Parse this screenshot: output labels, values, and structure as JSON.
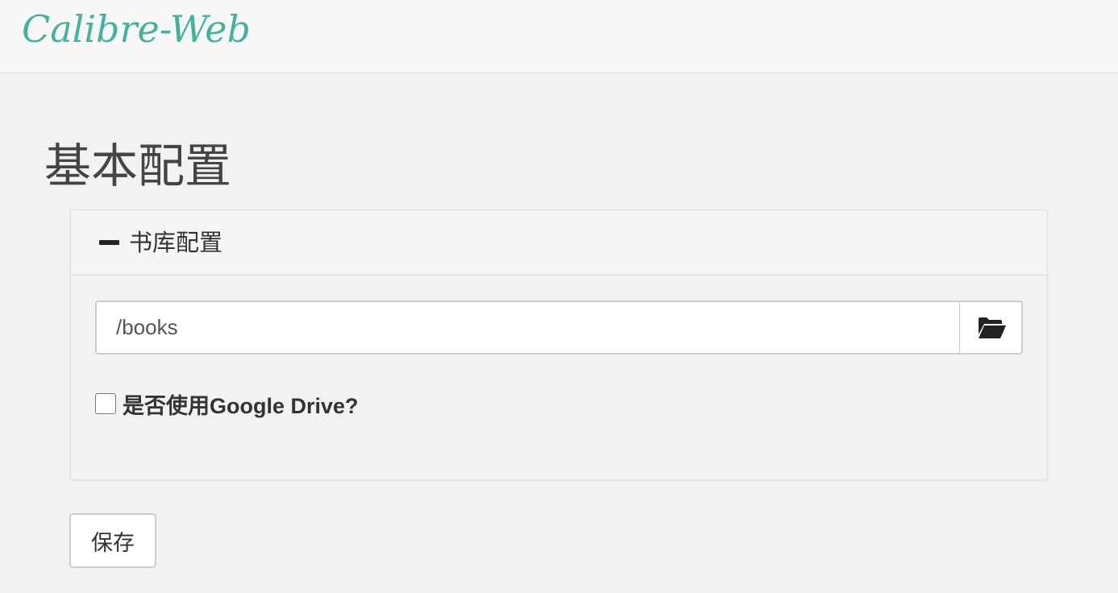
{
  "navbar": {
    "brand": "Calibre-Web"
  },
  "page": {
    "title": "基本配置"
  },
  "library_panel": {
    "heading": "书库配置",
    "collapse_icon": "minus-icon",
    "path_input": {
      "value": "/books"
    },
    "browse_icon": "folder-open-icon",
    "gdrive_checkbox": {
      "checked": false,
      "label": "是否使用Google Drive?"
    }
  },
  "actions": {
    "save_label": "保存"
  }
}
